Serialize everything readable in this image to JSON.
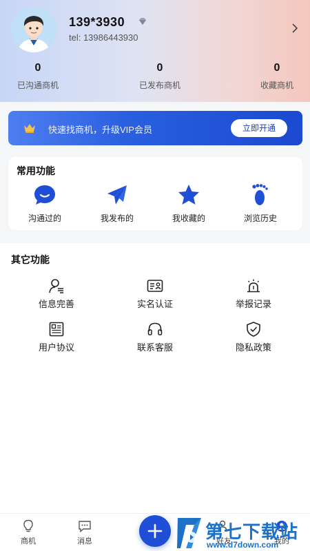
{
  "profile": {
    "name": "139*3930",
    "tel": "tel: 13986443930",
    "stats": [
      {
        "value": "0",
        "label": "已沟通商机"
      },
      {
        "value": "0",
        "label": "已发布商机"
      },
      {
        "value": "0",
        "label": "收藏商机"
      }
    ]
  },
  "vip": {
    "text": "快速找商机，升级VIP会员",
    "button": "立即开通"
  },
  "common": {
    "title": "常用功能",
    "items": [
      {
        "label": "沟通过的",
        "icon": "chat-bubble-icon"
      },
      {
        "label": "我发布的",
        "icon": "paper-plane-icon"
      },
      {
        "label": "我收藏的",
        "icon": "star-icon"
      },
      {
        "label": "浏览历史",
        "icon": "footprint-icon"
      }
    ]
  },
  "other": {
    "title": "其它功能",
    "items": [
      {
        "label": "信息完善",
        "icon": "user-info-icon"
      },
      {
        "label": "实名认证",
        "icon": "id-card-icon"
      },
      {
        "label": "举报记录",
        "icon": "alarm-icon"
      },
      {
        "label": "用户协议",
        "icon": "document-icon"
      },
      {
        "label": "联系客服",
        "icon": "headset-icon"
      },
      {
        "label": "隐私政策",
        "icon": "shield-check-icon"
      }
    ]
  },
  "nav": {
    "items": [
      {
        "label": "商机",
        "icon": "bulb-icon"
      },
      {
        "label": "消息",
        "icon": "message-icon"
      },
      {
        "label": "好友",
        "icon": "friends-icon"
      },
      {
        "label": "我的",
        "icon": "me-icon"
      }
    ]
  },
  "watermark": {
    "name": "第七下载站",
    "url": "www.d7down.com"
  },
  "colors": {
    "primary": "#1f4fd6",
    "vip_gradient_start": "#4f7ef0",
    "vip_gradient_end": "#1b49d1"
  }
}
